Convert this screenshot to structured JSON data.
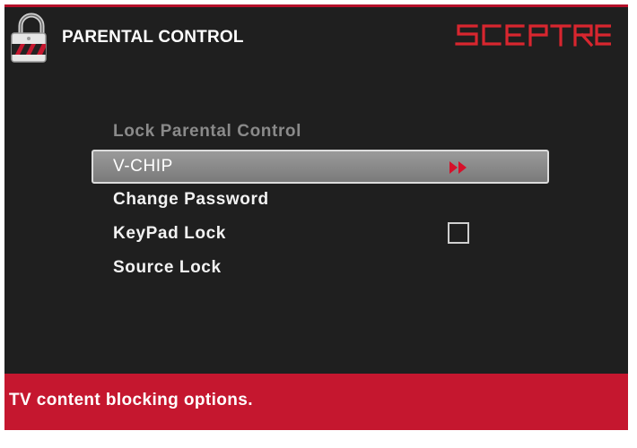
{
  "header": {
    "title": "PARENTAL CONTROL",
    "brand": "SCEPTRE",
    "icon": "padlock-icon"
  },
  "menu": {
    "items": [
      {
        "label": "Lock Parental Control",
        "state": "disabled"
      },
      {
        "label": "V-CHIP",
        "state": "selected",
        "indicator": "double-arrow-right-icon"
      },
      {
        "label": "Change Password",
        "state": "normal"
      },
      {
        "label": "KeyPad Lock",
        "state": "normal",
        "checkbox_checked": false
      },
      {
        "label": "Source Lock",
        "state": "normal"
      }
    ]
  },
  "footer": {
    "help_text": "TV content blocking options."
  },
  "colors": {
    "background": "#1f1f1f",
    "accent_red": "#c5172f",
    "selection_gray": "#8a8a8a"
  }
}
